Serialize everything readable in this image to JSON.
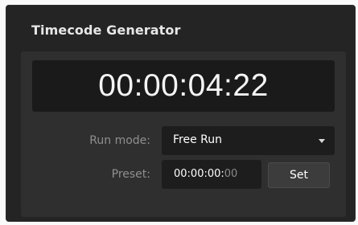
{
  "panel": {
    "title": "Timecode Generator"
  },
  "display": {
    "timecode": "00:00:04:22"
  },
  "run_mode": {
    "label": "Run mode:",
    "value": "Free Run"
  },
  "preset": {
    "label": "Preset:",
    "value_main": "00:00:00:",
    "value_suffix": "00",
    "button_label": "Set"
  }
}
